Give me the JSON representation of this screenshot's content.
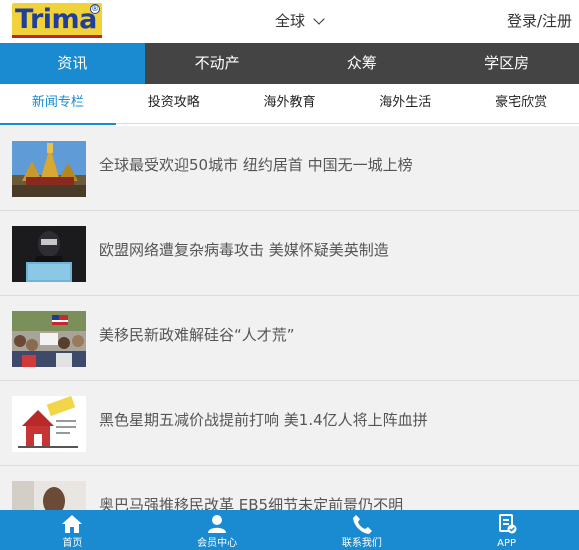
{
  "header": {
    "logo_text": "Trima",
    "logo_reg": "®",
    "region": "全球",
    "login": "登录/注册"
  },
  "main_tabs": [
    {
      "label": "资讯",
      "active": true
    },
    {
      "label": "不动产",
      "active": false
    },
    {
      "label": "众筹",
      "active": false
    },
    {
      "label": "学区房",
      "active": false
    }
  ],
  "sub_tabs": [
    {
      "label": "新闻专栏",
      "active": true
    },
    {
      "label": "投资攻略",
      "active": false
    },
    {
      "label": "海外教育",
      "active": false
    },
    {
      "label": "海外生活",
      "active": false
    },
    {
      "label": "豪宅欣赏",
      "active": false
    }
  ],
  "news": [
    {
      "title": "全球最受欢迎50城市 纽约居首 中国无一城上榜",
      "thumb": "temple-photo"
    },
    {
      "title": "欧盟网络遭复杂病毒攻击 美媒怀疑美英制造",
      "thumb": "hacker-photo"
    },
    {
      "title": "美移民新政难解硅谷“人才荒”",
      "thumb": "protest-photo"
    },
    {
      "title": "黑色星期五减价战提前打响 美1.4亿人将上阵血拼",
      "thumb": "house-sale-photo"
    },
    {
      "title": "奥巴马强推移民改革 EB5细节未定前景仍不明",
      "thumb": "obama-photo"
    }
  ],
  "bottom_nav": [
    {
      "label": "首页",
      "icon": "home-icon"
    },
    {
      "label": "会员中心",
      "icon": "user-icon"
    },
    {
      "label": "联系我们",
      "icon": "phone-icon"
    },
    {
      "label": "APP",
      "icon": "app-icon"
    }
  ],
  "colors": {
    "accent": "#1a8bd0",
    "tabbar": "#444444",
    "list_bg": "#f1f1f1"
  }
}
